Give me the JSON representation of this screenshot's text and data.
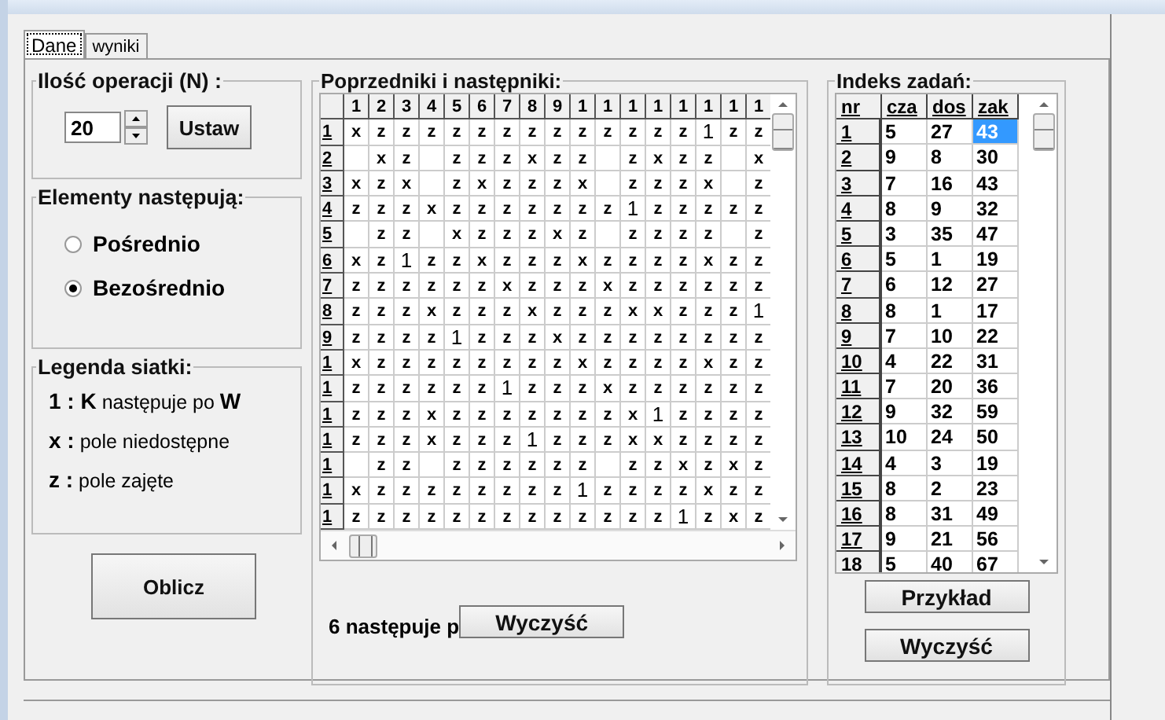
{
  "tabs": [
    {
      "label": "Dane",
      "selected": true
    },
    {
      "label": "wyniki",
      "selected": false
    }
  ],
  "operations": {
    "title": "Ilość operacji (N) :",
    "value": "20",
    "button": "Ustaw"
  },
  "succession": {
    "title": "Elementy następują:",
    "options": [
      {
        "label": "Pośrednio",
        "selected": false
      },
      {
        "label": "Bezośrednio",
        "selected": true
      }
    ]
  },
  "legend": {
    "title": "Legenda siatki:",
    "items": [
      "**1 : K** następuje po **W**",
      "**x :** pole niedostępne",
      "**z :** pole zajęte"
    ]
  },
  "compute_button": "Oblicz",
  "grid": {
    "title": "Poprzedniki i następniki:",
    "columns": [
      "1",
      "2",
      "3",
      "4",
      "5",
      "6",
      "7",
      "8",
      "9",
      "1",
      "1",
      "1",
      "1",
      "1",
      "1",
      "1",
      "1"
    ],
    "rows": [
      {
        "label": "1",
        "cells": [
          "x",
          "z",
          "z",
          "z",
          "z",
          "z",
          "z",
          "z",
          "z",
          "z",
          "z",
          "z",
          "z",
          "z",
          "1",
          "z",
          "z"
        ]
      },
      {
        "label": "2",
        "cells": [
          null,
          "x",
          "z",
          null,
          "z",
          "z",
          "z",
          "x",
          "z",
          "z",
          null,
          "z",
          "x",
          "z",
          "z",
          null,
          "x"
        ]
      },
      {
        "label": "3",
        "cells": [
          "x",
          "z",
          "x",
          null,
          "z",
          "x",
          "z",
          "z",
          "z",
          "x",
          null,
          "z",
          "z",
          "z",
          "x",
          null,
          "z"
        ]
      },
      {
        "label": "4",
        "cells": [
          "z",
          "z",
          "z",
          "x",
          "z",
          "z",
          "z",
          "z",
          "z",
          "z",
          "z",
          "1",
          "z",
          "z",
          "z",
          "z",
          "z"
        ]
      },
      {
        "label": "5",
        "cells": [
          null,
          "z",
          "z",
          null,
          "x",
          "z",
          "z",
          "z",
          "x",
          "z",
          null,
          "z",
          "z",
          "z",
          "z",
          null,
          "z"
        ]
      },
      {
        "label": "6",
        "cells": [
          "x",
          "z",
          "1",
          "z",
          "z",
          "x",
          "z",
          "z",
          "z",
          "x",
          "z",
          "z",
          "z",
          "z",
          "x",
          "z",
          "z"
        ]
      },
      {
        "label": "7",
        "cells": [
          "z",
          "z",
          "z",
          "z",
          "z",
          "z",
          "x",
          "z",
          "z",
          "z",
          "x",
          "z",
          "z",
          "z",
          "z",
          "z",
          "z"
        ]
      },
      {
        "label": "8",
        "cells": [
          "z",
          "z",
          "z",
          "x",
          "z",
          "z",
          "z",
          "x",
          "z",
          "z",
          "z",
          "x",
          "x",
          "z",
          "z",
          "z",
          "1"
        ]
      },
      {
        "label": "9",
        "cells": [
          "z",
          "z",
          "z",
          "z",
          "1",
          "z",
          "z",
          "z",
          "x",
          "z",
          "z",
          "z",
          "z",
          "z",
          "z",
          "z",
          "z"
        ]
      },
      {
        "label": "1",
        "cells": [
          "x",
          "z",
          "z",
          "z",
          "z",
          "z",
          "z",
          "z",
          "z",
          "x",
          "z",
          "z",
          "z",
          "z",
          "x",
          "z",
          "z"
        ]
      },
      {
        "label": "1",
        "cells": [
          "z",
          "z",
          "z",
          "z",
          "z",
          "z",
          "1",
          "z",
          "z",
          "z",
          "x",
          "z",
          "z",
          "z",
          "z",
          "z",
          "z"
        ]
      },
      {
        "label": "1",
        "cells": [
          "z",
          "z",
          "z",
          "x",
          "z",
          "z",
          "z",
          "z",
          "z",
          "z",
          "z",
          "x",
          "1",
          "z",
          "z",
          "z",
          "z"
        ]
      },
      {
        "label": "1",
        "cells": [
          "z",
          "z",
          "z",
          "x",
          "z",
          "z",
          "z",
          "1",
          "z",
          "z",
          "z",
          "x",
          "x",
          "z",
          "z",
          "z",
          "z"
        ]
      },
      {
        "label": "1",
        "cells": [
          null,
          "z",
          "z",
          null,
          "z",
          "z",
          "z",
          "z",
          "z",
          "z",
          null,
          "z",
          "z",
          "x",
          "z",
          "x",
          "z"
        ]
      },
      {
        "label": "1",
        "cells": [
          "x",
          "z",
          "z",
          "z",
          "z",
          "z",
          "z",
          "z",
          "z",
          "1",
          "z",
          "z",
          "z",
          "z",
          "x",
          "z",
          "z"
        ]
      },
      {
        "label": "1",
        "cells": [
          "z",
          "z",
          "z",
          "z",
          "z",
          "z",
          "z",
          "z",
          "z",
          "z",
          "z",
          "z",
          "z",
          "1",
          "z",
          "x",
          "z"
        ]
      }
    ],
    "result": "6 następuje p",
    "clear_button": "Wyczyść"
  },
  "index": {
    "title": "Indeks zadań:",
    "columns": [
      "nr",
      "cza",
      "dos",
      "zak"
    ],
    "rows": [
      {
        "nr": "1",
        "values": [
          "5",
          "27",
          "43"
        ],
        "selected": true
      },
      {
        "nr": "2",
        "values": [
          "9",
          "8",
          "30"
        ],
        "selected": false
      },
      {
        "nr": "3",
        "values": [
          "7",
          "16",
          "43"
        ],
        "selected": false
      },
      {
        "nr": "4",
        "values": [
          "8",
          "9",
          "32"
        ],
        "selected": false
      },
      {
        "nr": "5",
        "values": [
          "3",
          "35",
          "47"
        ],
        "selected": false
      },
      {
        "nr": "6",
        "values": [
          "5",
          "1",
          "19"
        ],
        "selected": false
      },
      {
        "nr": "7",
        "values": [
          "6",
          "12",
          "27"
        ],
        "selected": false
      },
      {
        "nr": "8",
        "values": [
          "8",
          "1",
          "17"
        ],
        "selected": false
      },
      {
        "nr": "9",
        "values": [
          "7",
          "10",
          "22"
        ],
        "selected": false
      },
      {
        "nr": "10",
        "values": [
          "4",
          "22",
          "31"
        ],
        "selected": false
      },
      {
        "nr": "11",
        "values": [
          "7",
          "20",
          "36"
        ],
        "selected": false
      },
      {
        "nr": "12",
        "values": [
          "9",
          "32",
          "59"
        ],
        "selected": false
      },
      {
        "nr": "13",
        "values": [
          "10",
          "24",
          "50"
        ],
        "selected": false
      },
      {
        "nr": "14",
        "values": [
          "4",
          "3",
          "19"
        ],
        "selected": false
      },
      {
        "nr": "15",
        "values": [
          "8",
          "2",
          "23"
        ],
        "selected": false
      },
      {
        "nr": "16",
        "values": [
          "8",
          "31",
          "49"
        ],
        "selected": false
      },
      {
        "nr": "17",
        "values": [
          "9",
          "21",
          "56"
        ],
        "selected": false
      },
      {
        "nr": "18",
        "values": [
          "5",
          "40",
          "67"
        ],
        "selected": false
      }
    ],
    "example_button": "Przykład",
    "clear_button": "Wyczyść"
  }
}
